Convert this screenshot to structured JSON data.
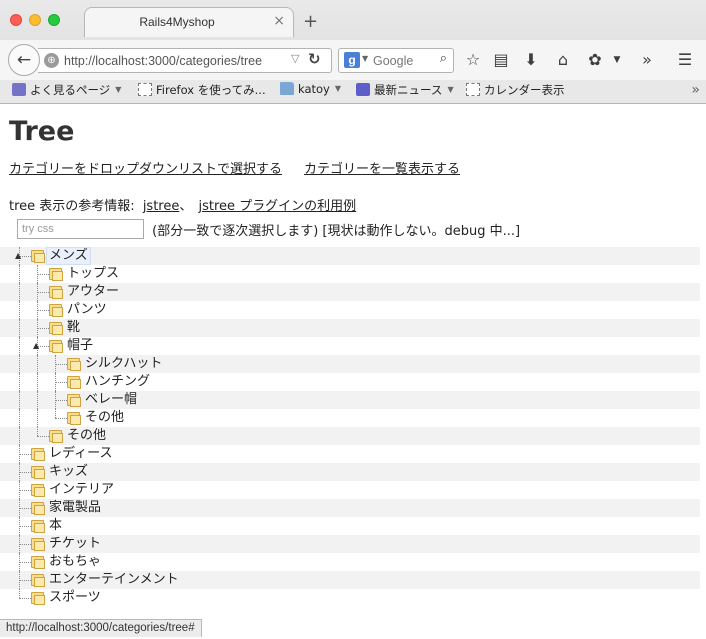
{
  "browser": {
    "tab_title": "Rails4Myshop",
    "tab_close": "×",
    "new_tab": "+",
    "url": "http://localhost:3000/categories/tree",
    "search_engine_placeholder": "Google",
    "toolbar_icons": [
      "back-icon",
      "reload-icon",
      "star-icon",
      "reading-list-icon",
      "download-icon",
      "home-icon",
      "addon-icon",
      "overflow-icon",
      "menu-icon"
    ],
    "bookmarks": [
      {
        "label": "よく見るページ",
        "icon": "most-visited-icon",
        "has_caret": true
      },
      {
        "label": "Firefox を使ってみ...",
        "icon": "blank-page-icon",
        "has_caret": false
      },
      {
        "label": "katoy",
        "icon": "folder-icon",
        "has_caret": true
      },
      {
        "label": "最新ニュース",
        "icon": "rss-icon",
        "has_caret": true
      },
      {
        "label": "カレンダー表示",
        "icon": "blank-page-icon",
        "has_caret": false
      }
    ],
    "status_url": "http://localhost:3000/categories/tree#"
  },
  "page": {
    "title": "Tree",
    "links": {
      "dropdown": "カテゴリーをドロップダウンリストで選択する",
      "list": "カテゴリーを一覧表示する"
    },
    "reference": {
      "prefix": "tree 表示の参考情報:",
      "link1": "jstree",
      "separator": "、",
      "link2": "jstree プラグインの利用例"
    },
    "search": {
      "placeholder": "try css",
      "note": "(部分一致で逐次選択します) [現状は動作しない。debug 中...]"
    }
  },
  "tree": [
    {
      "label": "メンズ",
      "depth": 0,
      "expanded": true,
      "selected": true,
      "children": [
        {
          "label": "トップス"
        },
        {
          "label": "アウター"
        },
        {
          "label": "パンツ"
        },
        {
          "label": "靴"
        },
        {
          "label": "帽子",
          "expanded": true,
          "children": [
            {
              "label": "シルクハット"
            },
            {
              "label": "ハンチング"
            },
            {
              "label": "ベレー帽"
            },
            {
              "label": "その他"
            }
          ]
        },
        {
          "label": "その他"
        }
      ]
    },
    {
      "label": "レディース"
    },
    {
      "label": "キッズ"
    },
    {
      "label": "インテリア"
    },
    {
      "label": "家電製品"
    },
    {
      "label": "本"
    },
    {
      "label": "チケット"
    },
    {
      "label": "おもちゃ"
    },
    {
      "label": "エンターテインメント"
    },
    {
      "label": "スポーツ"
    }
  ],
  "colors": {
    "row_stripe": "#f2f2f2",
    "selected_bg": "#e9f0fb",
    "folder_fill": "#f7dd8e"
  }
}
